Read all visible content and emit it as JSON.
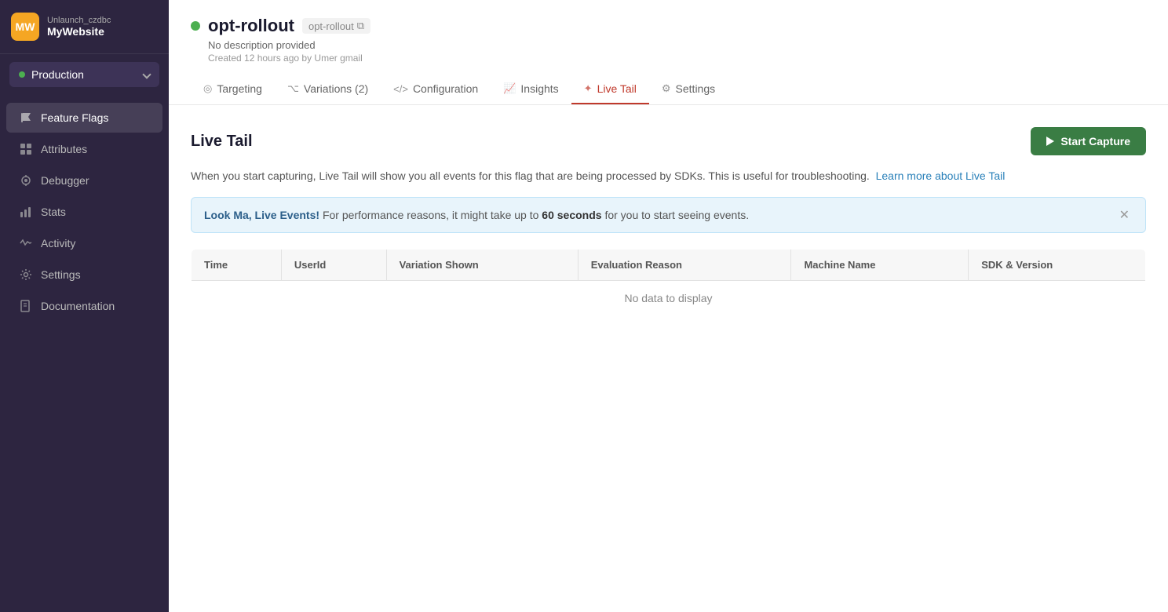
{
  "sidebar": {
    "org_abbr": "MW",
    "org_sub": "Unlaunch_czdbc",
    "org_name": "MyWebsite",
    "env": {
      "label": "Production",
      "dot_color": "#4caf50"
    },
    "nav_items": [
      {
        "id": "feature-flags",
        "label": "Feature Flags",
        "icon": "flag",
        "active": true
      },
      {
        "id": "attributes",
        "label": "Attributes",
        "icon": "grid"
      },
      {
        "id": "debugger",
        "label": "Debugger",
        "icon": "debug"
      },
      {
        "id": "stats",
        "label": "Stats",
        "icon": "bar-chart"
      },
      {
        "id": "activity",
        "label": "Activity",
        "icon": "activity"
      },
      {
        "id": "settings",
        "label": "Settings",
        "icon": "settings"
      },
      {
        "id": "documentation",
        "label": "Documentation",
        "icon": "book"
      }
    ]
  },
  "flag": {
    "name": "opt-rollout",
    "slug": "opt-rollout",
    "status": "active",
    "description": "No description provided",
    "meta": "Created 12 hours ago by Umer gmail"
  },
  "tabs": [
    {
      "id": "targeting",
      "label": "Targeting",
      "icon": "◎",
      "active": false
    },
    {
      "id": "variations",
      "label": "Variations (2)",
      "icon": "⌥",
      "active": false
    },
    {
      "id": "configuration",
      "label": "Configuration",
      "icon": "</>",
      "active": false
    },
    {
      "id": "insights",
      "label": "Insights",
      "icon": "📈",
      "active": false
    },
    {
      "id": "live-tail",
      "label": "Live Tail",
      "icon": "✦",
      "active": true
    },
    {
      "id": "settings",
      "label": "Settings",
      "icon": "⚙",
      "active": false
    }
  ],
  "live_tail": {
    "title": "Live Tail",
    "start_capture_label": "Start Capture",
    "description_text": "When you start capturing, Live Tail will show you all events for this flag that are being processed by SDKs. This is useful for troubleshooting.",
    "learn_link_text": "Learn more about Live Tail",
    "banner_text_prefix": "Look Ma, Live Events!",
    "banner_text_body": " For performance reasons, it might take up to ",
    "banner_bold_time": "60 seconds",
    "banner_text_suffix": " for you to start seeing events.",
    "table": {
      "columns": [
        "Time",
        "UserId",
        "Variation Shown",
        "Evaluation Reason",
        "Machine Name",
        "SDK & Version"
      ],
      "empty_text": "No data to display"
    }
  }
}
